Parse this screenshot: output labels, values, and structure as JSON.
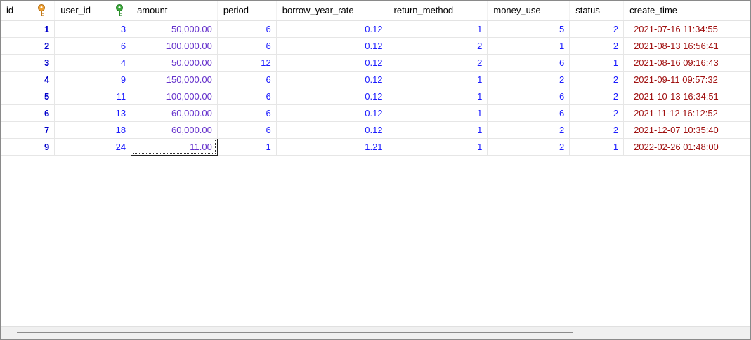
{
  "columns": {
    "id": "id",
    "user_id": "user_id",
    "amount": "amount",
    "period": "period",
    "borrow_year_rate": "borrow_year_rate",
    "return_method": "return_method",
    "money_use": "money_use",
    "status": "status",
    "create_time": "create_time"
  },
  "icons": {
    "primary_key": "primary-key-icon",
    "foreign_key": "foreign-key-icon",
    "primary_color": "#f0a030",
    "foreign_color": "#3aa83a"
  },
  "rows": [
    [
      "1",
      "3",
      "50,000.00",
      "6",
      "0.12",
      "1",
      "5",
      "2",
      "2021-07-16 11:34:55"
    ],
    [
      "2",
      "6",
      "100,000.00",
      "6",
      "0.12",
      "2",
      "1",
      "2",
      "2021-08-13 16:56:41"
    ],
    [
      "3",
      "4",
      "50,000.00",
      "12",
      "0.12",
      "2",
      "6",
      "1",
      "2021-08-16 09:16:43"
    ],
    [
      "4",
      "9",
      "150,000.00",
      "6",
      "0.12",
      "1",
      "2",
      "2",
      "2021-09-11 09:57:32"
    ],
    [
      "5",
      "11",
      "100,000.00",
      "6",
      "0.12",
      "1",
      "6",
      "2",
      "2021-10-13 16:34:51"
    ],
    [
      "6",
      "13",
      "60,000.00",
      "6",
      "0.12",
      "1",
      "6",
      "2",
      "2021-11-12 16:12:52"
    ],
    [
      "7",
      "18",
      "60,000.00",
      "6",
      "0.12",
      "1",
      "2",
      "2",
      "2021-12-07 10:35:40"
    ],
    [
      "9",
      "24",
      "11.00",
      "1",
      "1.21",
      "1",
      "2",
      "1",
      "2022-02-26 01:48:00"
    ]
  ],
  "selected_cell": {
    "row": 7,
    "col": 2
  }
}
